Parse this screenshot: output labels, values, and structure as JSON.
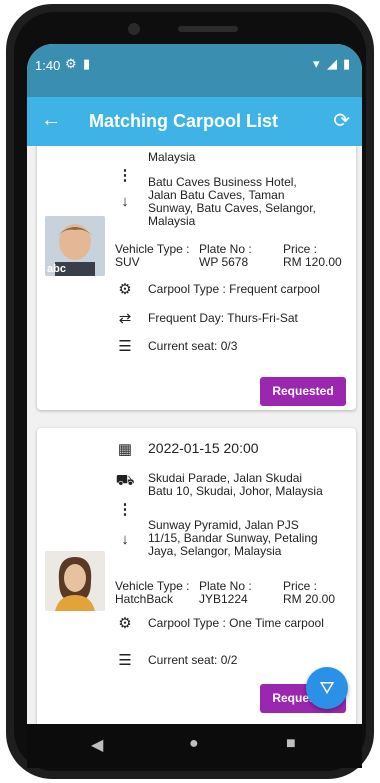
{
  "status": {
    "time": "1:40"
  },
  "header": {
    "title": "Matching Carpool List"
  },
  "cards": [
    {
      "pickup_tail": "Malaysia",
      "dropoff": "Batu Caves Business Hotel, Jalan Batu Caves, Taman Sunway, Batu Caves, Selangor, Malaysia",
      "vehicle_type_label": "Vehicle Type :",
      "vehicle_type": "SUV",
      "plate_label": "Plate No :",
      "plate": "WP 5678",
      "price_label": "Price :",
      "price": "RM 120.00",
      "carpool_type": "Carpool Type : Frequent carpool",
      "frequent_day": "Frequent Day: Thurs-Fri-Sat",
      "seat": "Current seat: 0/3",
      "button": "Requested"
    },
    {
      "datetime": "2022-01-15 20:00",
      "pickup": "Skudai Parade, Jalan Skudai Batu 10, Skudai, Johor, Malaysia",
      "dropoff": "Sunway Pyramid, Jalan PJS 11/15, Bandar Sunway, Petaling Jaya, Selangor, Malaysia",
      "vehicle_type_label": "Vehicle Type :",
      "vehicle_type": "HatchBack",
      "plate_label": "Plate No :",
      "plate": "JYB1224",
      "price_label": "Price :",
      "price": "RM 20.00",
      "carpool_type": "Carpool Type : One Time carpool",
      "seat": "Current seat: 0/2",
      "button": "Requested"
    }
  ]
}
